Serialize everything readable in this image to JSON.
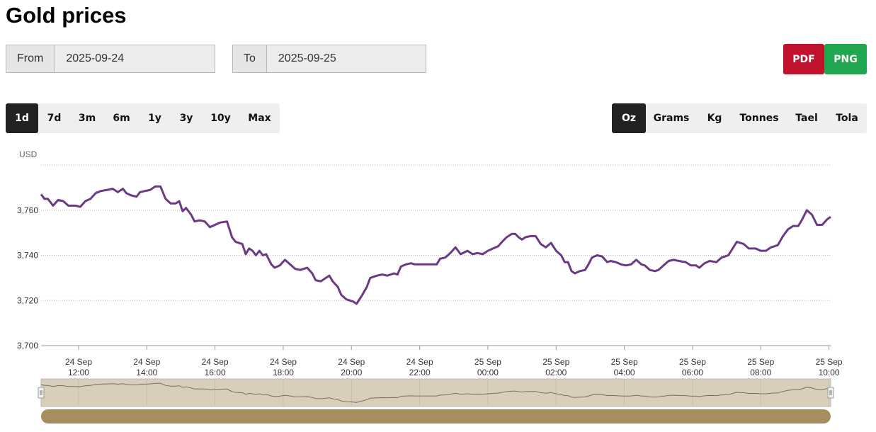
{
  "page_title": "Gold prices",
  "date_range": {
    "from_label": "From",
    "from_value": "2025-09-24",
    "to_label": "To",
    "to_value": "2025-09-25"
  },
  "export": {
    "pdf_label": "PDF",
    "pdf_color": "#c0122c",
    "png_label": "PNG",
    "png_color": "#1fa64f"
  },
  "range_buttons": [
    {
      "label": "1d",
      "active": true
    },
    {
      "label": "7d",
      "active": false
    },
    {
      "label": "3m",
      "active": false
    },
    {
      "label": "6m",
      "active": false
    },
    {
      "label": "1y",
      "active": false
    },
    {
      "label": "3y",
      "active": false
    },
    {
      "label": "10y",
      "active": false
    },
    {
      "label": "Max",
      "active": false
    }
  ],
  "unit_buttons": [
    {
      "label": "Oz",
      "active": true
    },
    {
      "label": "Grams",
      "active": false
    },
    {
      "label": "Kg",
      "active": false
    },
    {
      "label": "Tonnes",
      "active": false
    },
    {
      "label": "Tael",
      "active": false
    },
    {
      "label": "Tola",
      "active": false
    }
  ],
  "chart_data": {
    "type": "line",
    "title": "",
    "ylabel": "USD",
    "xlabel": "",
    "ylim": [
      3700,
      3780
    ],
    "xlim_hours": [
      10.9,
      34.05
    ],
    "yticks": [
      3700,
      3720,
      3740,
      3760
    ],
    "ytick_labels": [
      "3,700",
      "3,720",
      "3,740",
      "3,760"
    ],
    "xticks": [
      {
        "h": 12,
        "l1": "24 Sep",
        "l2": "12:00"
      },
      {
        "h": 14,
        "l1": "24 Sep",
        "l2": "14:00"
      },
      {
        "h": 16,
        "l1": "24 Sep",
        "l2": "16:00"
      },
      {
        "h": 18,
        "l1": "24 Sep",
        "l2": "18:00"
      },
      {
        "h": 20,
        "l1": "24 Sep",
        "l2": "20:00"
      },
      {
        "h": 22,
        "l1": "24 Sep",
        "l2": "22:00"
      },
      {
        "h": 24,
        "l1": "25 Sep",
        "l2": "00:00"
      },
      {
        "h": 26,
        "l1": "25 Sep",
        "l2": "02:00"
      },
      {
        "h": 28,
        "l1": "25 Sep",
        "l2": "04:00"
      },
      {
        "h": 30,
        "l1": "25 Sep",
        "l2": "06:00"
      },
      {
        "h": 32,
        "l1": "25 Sep",
        "l2": "08:00"
      },
      {
        "h": 34,
        "l1": "25 Sep",
        "l2": "10:00"
      }
    ],
    "grid": true,
    "line_color": "#6b3a84",
    "navigator_color": "#d8cfba",
    "scrollbar_color": "#a58f5e",
    "series": [
      {
        "name": "",
        "points": [
          [
            10.9,
            3767
          ],
          [
            11.0,
            3765
          ],
          [
            11.1,
            3765
          ],
          [
            11.25,
            3762
          ],
          [
            11.4,
            3764.5
          ],
          [
            11.55,
            3764
          ],
          [
            11.7,
            3762
          ],
          [
            11.9,
            3762
          ],
          [
            12.05,
            3761.5
          ],
          [
            12.2,
            3764
          ],
          [
            12.35,
            3765
          ],
          [
            12.5,
            3767.5
          ],
          [
            12.65,
            3768.5
          ],
          [
            12.85,
            3769
          ],
          [
            13.0,
            3769.5
          ],
          [
            13.15,
            3768
          ],
          [
            13.3,
            3769.5
          ],
          [
            13.4,
            3767.5
          ],
          [
            13.55,
            3766.5
          ],
          [
            13.7,
            3766
          ],
          [
            13.8,
            3768
          ],
          [
            13.95,
            3768.5
          ],
          [
            14.1,
            3769
          ],
          [
            14.25,
            3770.5
          ],
          [
            14.4,
            3770.5
          ],
          [
            14.55,
            3765
          ],
          [
            14.7,
            3763
          ],
          [
            14.85,
            3763
          ],
          [
            14.95,
            3764
          ],
          [
            15.05,
            3759.5
          ],
          [
            15.15,
            3761
          ],
          [
            15.3,
            3758
          ],
          [
            15.4,
            3755
          ],
          [
            15.55,
            3755.5
          ],
          [
            15.7,
            3755
          ],
          [
            15.85,
            3752.5
          ],
          [
            16.0,
            3753.5
          ],
          [
            16.15,
            3754.5
          ],
          [
            16.35,
            3755
          ],
          [
            16.5,
            3748
          ],
          [
            16.6,
            3746
          ],
          [
            16.8,
            3745
          ],
          [
            16.9,
            3740.5
          ],
          [
            17.0,
            3743
          ],
          [
            17.1,
            3742
          ],
          [
            17.2,
            3740
          ],
          [
            17.3,
            3742
          ],
          [
            17.4,
            3740
          ],
          [
            17.5,
            3740.5
          ],
          [
            17.65,
            3736
          ],
          [
            17.75,
            3734.5
          ],
          [
            17.9,
            3735.5
          ],
          [
            18.05,
            3738
          ],
          [
            18.2,
            3736
          ],
          [
            18.35,
            3734
          ],
          [
            18.5,
            3733.5
          ],
          [
            18.7,
            3734.5
          ],
          [
            18.85,
            3732
          ],
          [
            18.95,
            3729
          ],
          [
            19.1,
            3728.5
          ],
          [
            19.25,
            3730
          ],
          [
            19.35,
            3731
          ],
          [
            19.45,
            3728.5
          ],
          [
            19.6,
            3726
          ],
          [
            19.7,
            3722.5
          ],
          [
            19.85,
            3720.5
          ],
          [
            19.95,
            3720
          ],
          [
            20.05,
            3719.5
          ],
          [
            20.15,
            3718.5
          ],
          [
            20.3,
            3722
          ],
          [
            20.45,
            3726
          ],
          [
            20.55,
            3730
          ],
          [
            20.75,
            3731
          ],
          [
            20.9,
            3731.5
          ],
          [
            21.05,
            3731
          ],
          [
            21.25,
            3732
          ],
          [
            21.35,
            3731.5
          ],
          [
            21.45,
            3735
          ],
          [
            21.6,
            3736
          ],
          [
            21.75,
            3736.5
          ],
          [
            21.85,
            3736
          ],
          [
            22.0,
            3736
          ],
          [
            22.2,
            3736
          ],
          [
            22.4,
            3736
          ],
          [
            22.5,
            3736
          ],
          [
            22.6,
            3738.5
          ],
          [
            22.75,
            3739
          ],
          [
            22.9,
            3741
          ],
          [
            23.05,
            3743.5
          ],
          [
            23.2,
            3740.5
          ],
          [
            23.4,
            3742
          ],
          [
            23.55,
            3740.5
          ],
          [
            23.7,
            3741
          ],
          [
            23.85,
            3740.5
          ],
          [
            24.0,
            3742
          ],
          [
            24.15,
            3743
          ],
          [
            24.3,
            3744
          ],
          [
            24.45,
            3746.5
          ],
          [
            24.55,
            3748
          ],
          [
            24.7,
            3749.5
          ],
          [
            24.8,
            3749.5
          ],
          [
            24.9,
            3748
          ],
          [
            25.0,
            3747
          ],
          [
            25.1,
            3748
          ],
          [
            25.25,
            3748.5
          ],
          [
            25.4,
            3748.5
          ],
          [
            25.55,
            3745
          ],
          [
            25.7,
            3743.5
          ],
          [
            25.85,
            3745.5
          ],
          [
            26.0,
            3742
          ],
          [
            26.15,
            3740
          ],
          [
            26.25,
            3737
          ],
          [
            26.35,
            3737
          ],
          [
            26.45,
            3733
          ],
          [
            26.55,
            3732
          ],
          [
            26.7,
            3733
          ],
          [
            26.85,
            3733.5
          ],
          [
            26.95,
            3736
          ],
          [
            27.05,
            3739
          ],
          [
            27.2,
            3740
          ],
          [
            27.35,
            3739.5
          ],
          [
            27.5,
            3737
          ],
          [
            27.6,
            3737.5
          ],
          [
            27.75,
            3737
          ],
          [
            27.9,
            3736
          ],
          [
            28.05,
            3735.5
          ],
          [
            28.2,
            3736
          ],
          [
            28.35,
            3738
          ],
          [
            28.5,
            3736
          ],
          [
            28.6,
            3735.5
          ],
          [
            28.75,
            3733.5
          ],
          [
            28.9,
            3733
          ],
          [
            29.0,
            3733.5
          ],
          [
            29.15,
            3735.5
          ],
          [
            29.3,
            3737.5
          ],
          [
            29.45,
            3738
          ],
          [
            29.6,
            3737.5
          ],
          [
            29.8,
            3737
          ],
          [
            29.95,
            3735.5
          ],
          [
            30.1,
            3735.5
          ],
          [
            30.2,
            3734.5
          ],
          [
            30.35,
            3736.5
          ],
          [
            30.5,
            3737.5
          ],
          [
            30.7,
            3737
          ],
          [
            30.85,
            3739
          ],
          [
            31.05,
            3740
          ],
          [
            31.3,
            3746
          ],
          [
            31.5,
            3745
          ],
          [
            31.65,
            3743
          ],
          [
            31.85,
            3743
          ],
          [
            32.0,
            3742
          ],
          [
            32.15,
            3742
          ],
          [
            32.3,
            3743.5
          ],
          [
            32.5,
            3744.5
          ],
          [
            32.65,
            3748.5
          ],
          [
            32.8,
            3751.5
          ],
          [
            32.95,
            3753
          ],
          [
            33.1,
            3753
          ],
          [
            33.2,
            3755.5
          ],
          [
            33.35,
            3760
          ],
          [
            33.5,
            3758
          ],
          [
            33.65,
            3753.5
          ],
          [
            33.8,
            3753.5
          ],
          [
            33.95,
            3756
          ],
          [
            34.05,
            3757
          ]
        ]
      }
    ]
  }
}
